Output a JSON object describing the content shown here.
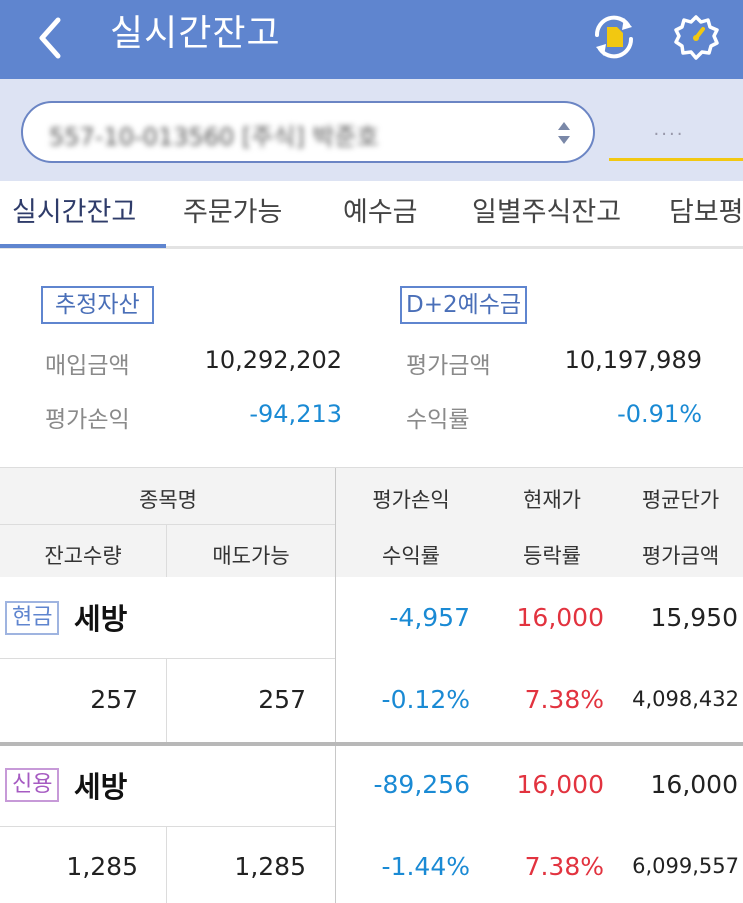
{
  "header": {
    "title": "실시간잔고"
  },
  "account": {
    "value": "557-10-013560 [주식] 박준호",
    "more": "...."
  },
  "tabs": [
    {
      "label": "실시간잔고",
      "active": true
    },
    {
      "label": "주문가능",
      "active": false
    },
    {
      "label": "예수금",
      "active": false
    },
    {
      "label": "일별주식잔고",
      "active": false
    },
    {
      "label": "담보평",
      "active": false
    }
  ],
  "summary": {
    "badge_left": "추정자산",
    "badge_right": "D+2예수금",
    "purchase_label": "매입금액",
    "purchase_value": "10,292,202",
    "pl_label": "평가손익",
    "pl_value": "-94,213",
    "eval_label": "평가금액",
    "eval_value": "10,197,989",
    "rate_label": "수익률",
    "rate_value": "-0.91%"
  },
  "table": {
    "headers_row1": {
      "name": "종목명",
      "pl": "평가손익",
      "price": "현재가",
      "avg": "평균단가"
    },
    "headers_row2": {
      "qty": "잔고수량",
      "sellable": "매도가능",
      "rate": "수익률",
      "change": "등락률",
      "eval": "평가금액"
    },
    "rows": [
      {
        "tag": "현금",
        "name": "세방",
        "pl": "-4,957",
        "price": "16,000",
        "avg": "15,950",
        "qty": "257",
        "sellable": "257",
        "rate": "-0.12%",
        "change": "7.38%",
        "eval": "4,098,432"
      },
      {
        "tag": "신용",
        "name": "세방",
        "pl": "-89,256",
        "price": "16,000",
        "avg": "16,000",
        "qty": "1,285",
        "sellable": "1,285",
        "rate": "-1.44%",
        "change": "7.38%",
        "eval": "6,099,557"
      }
    ]
  },
  "colors": {
    "header": "#5f85cf",
    "positive": "#e2333f",
    "negative": "#1a8ad4",
    "cash_tag": "#5f85cf",
    "credit_tag": "#a65bc2"
  },
  "icons": {
    "back": "chevron-left-icon",
    "refresh": "refresh-document-icon",
    "settings": "gear-icon"
  }
}
